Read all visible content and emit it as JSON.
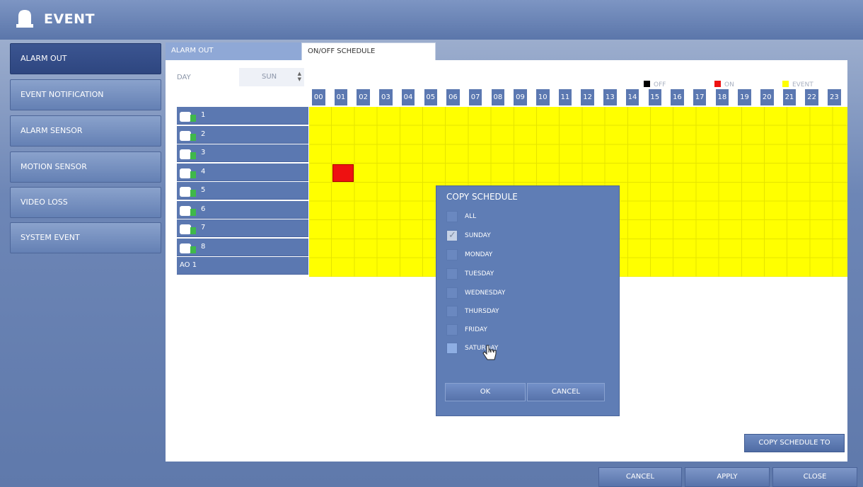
{
  "window": {
    "title": "EVENT",
    "icon": "alarm-icon"
  },
  "sidebar": {
    "items": [
      {
        "label": "ALARM OUT",
        "active": true
      },
      {
        "label": "EVENT NOTIFICATION"
      },
      {
        "label": "ALARM SENSOR"
      },
      {
        "label": "MOTION SENSOR"
      },
      {
        "label": "VIDEO LOSS"
      },
      {
        "label": "SYSTEM EVENT"
      }
    ]
  },
  "tabs": [
    {
      "label": "ALARM OUT"
    },
    {
      "label": "ON/OFF SCHEDULE",
      "active": true
    }
  ],
  "day": {
    "label": "DAY",
    "value": "SUN"
  },
  "legend": [
    {
      "label": "OFF",
      "color": "#000000"
    },
    {
      "label": "ON",
      "color": "#ee1111"
    },
    {
      "label": "EVENT",
      "color": "#ffff00"
    }
  ],
  "schedule": {
    "hours": [
      "00",
      "01",
      "02",
      "03",
      "04",
      "05",
      "06",
      "07",
      "08",
      "09",
      "10",
      "11",
      "12",
      "13",
      "14",
      "15",
      "16",
      "17",
      "18",
      "19",
      "20",
      "21",
      "22",
      "23"
    ],
    "rows": [
      "1",
      "2",
      "3",
      "4",
      "5",
      "6",
      "7",
      "8",
      "AO 1"
    ],
    "on_cells": [
      {
        "row": "4",
        "hour": "01"
      }
    ],
    "default_state": "EVENT"
  },
  "copy_schedule_to": "COPY SCHEDULE TO",
  "dialog": {
    "title": "COPY SCHEDULE",
    "options": [
      {
        "label": "ALL",
        "checked": false
      },
      {
        "label": "SUNDAY",
        "checked": true
      },
      {
        "label": "MONDAY",
        "checked": false
      },
      {
        "label": "TUESDAY",
        "checked": false
      },
      {
        "label": "WEDNESDAY",
        "checked": false
      },
      {
        "label": "THURSDAY",
        "checked": false
      },
      {
        "label": "FRIDAY",
        "checked": false
      },
      {
        "label": "SATURDAY",
        "checked": false
      }
    ],
    "ok": "OK",
    "cancel": "CANCEL"
  },
  "footer": {
    "cancel": "CANCEL",
    "apply": "APPLY",
    "close": "CLOSE"
  }
}
